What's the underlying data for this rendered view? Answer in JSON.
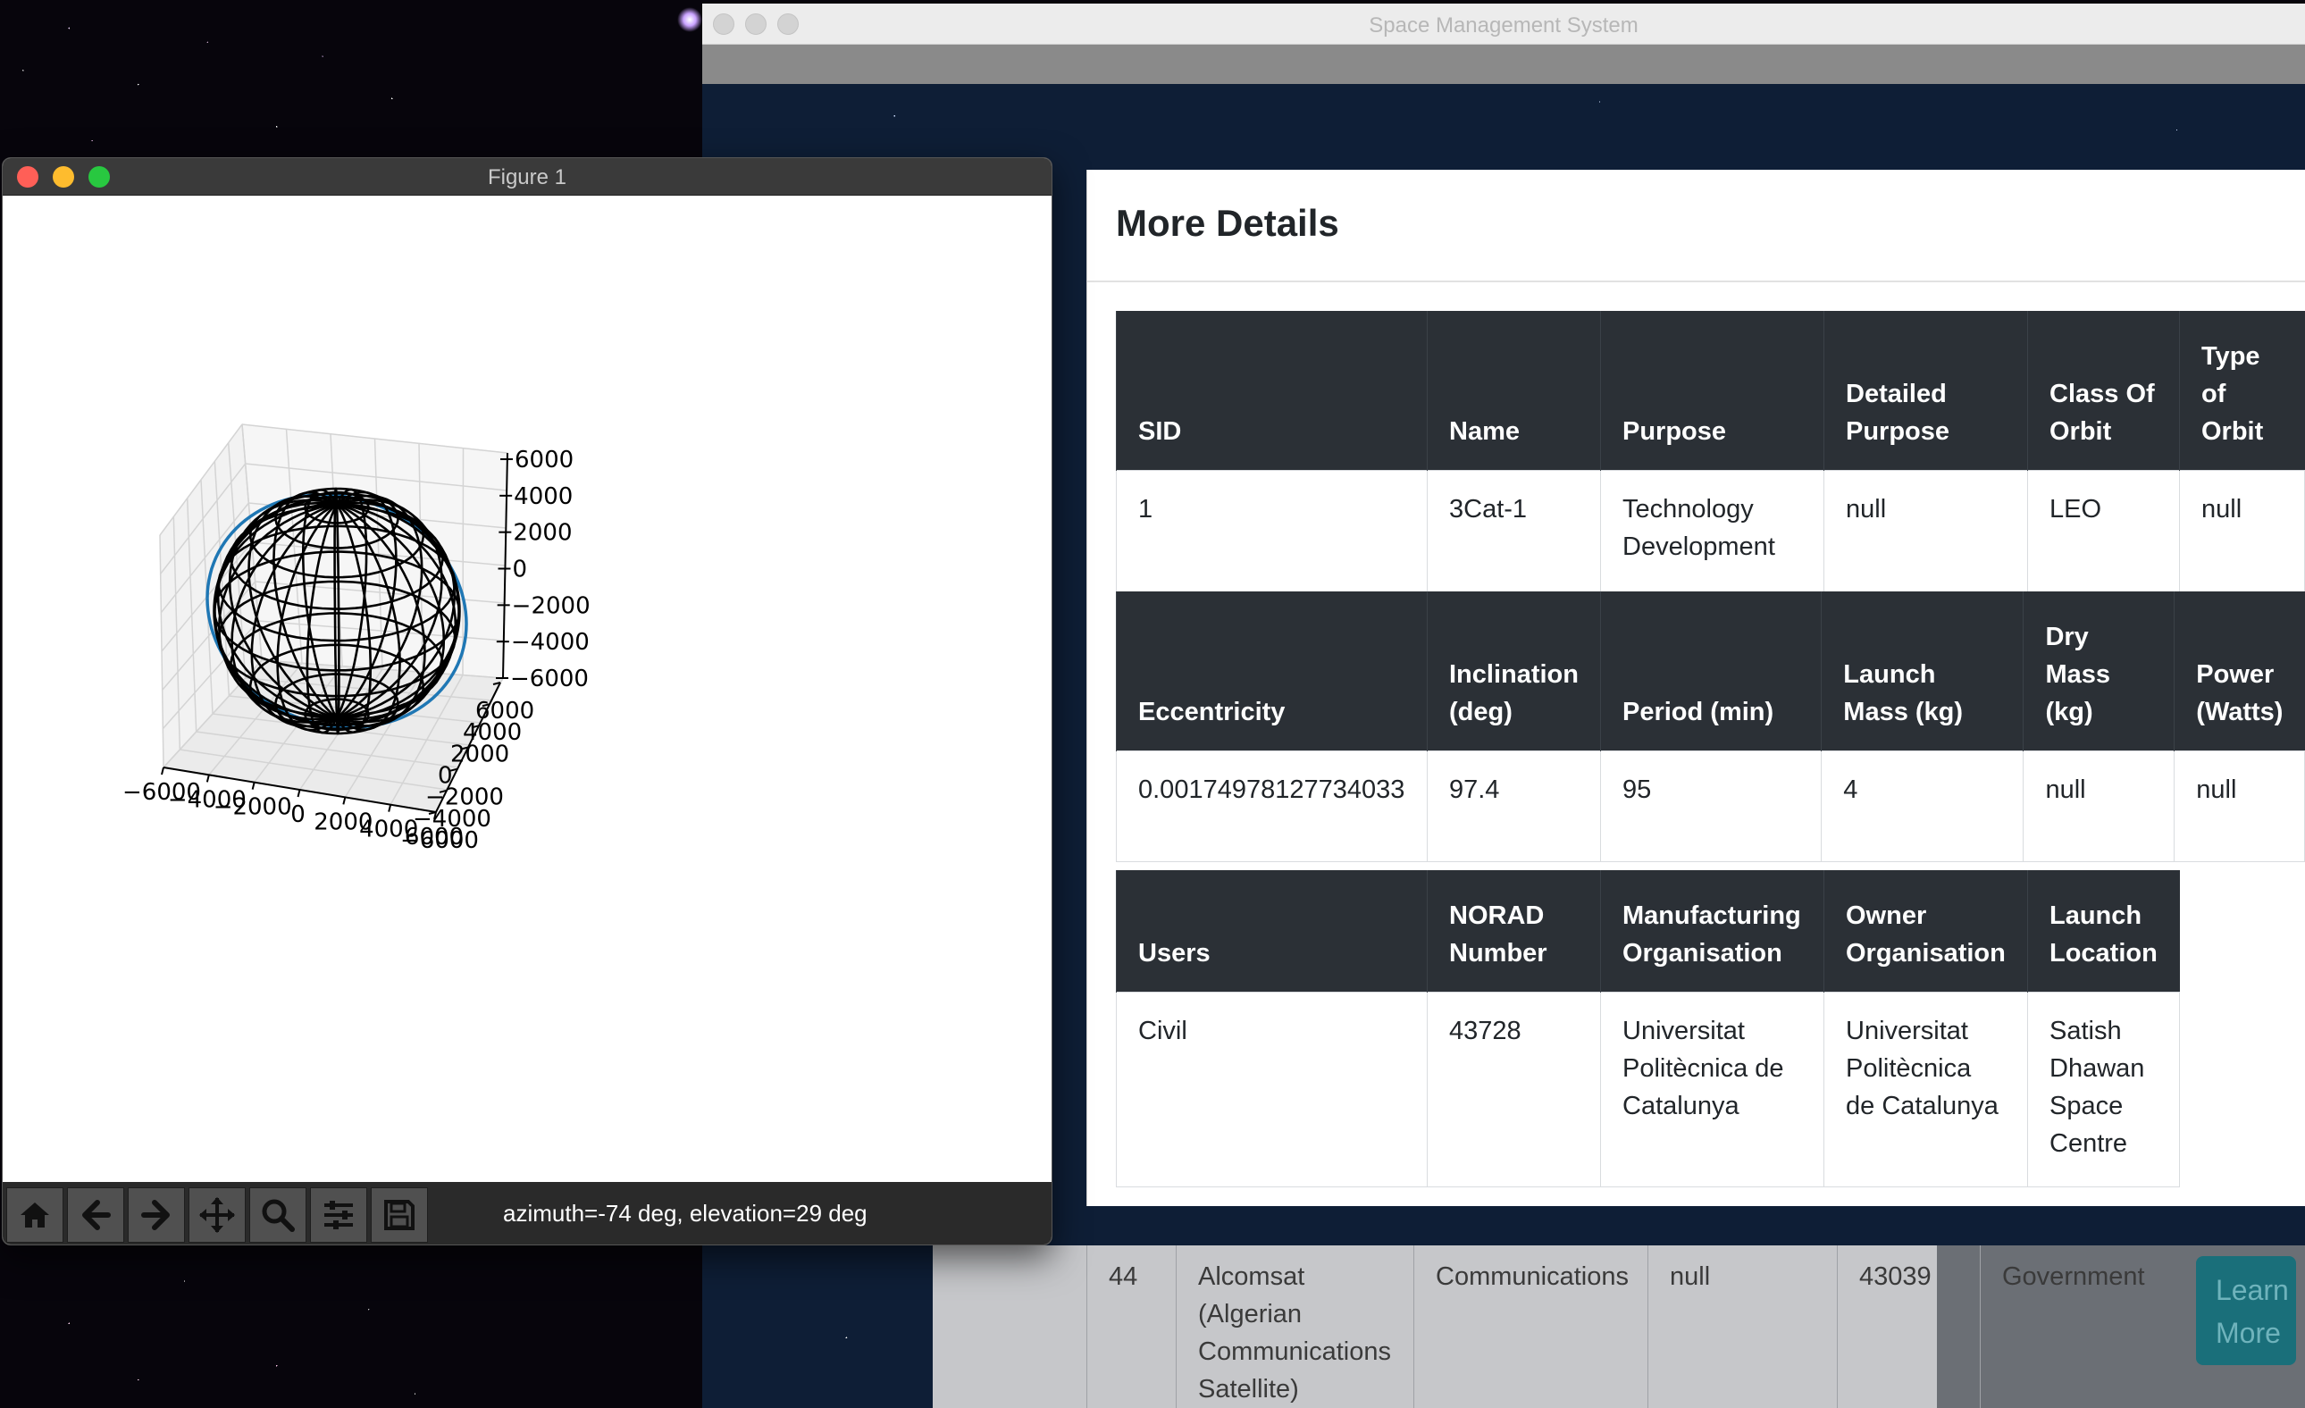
{
  "main_window": {
    "title": "Space Management System",
    "background_row": {
      "cells": [
        "44",
        "Alcomsat (Algerian Communications Satellite)",
        "Communications",
        "null",
        "43039",
        "Government"
      ],
      "button_label": "Learn More"
    },
    "modal": {
      "title": "More Details",
      "rows": [
        {
          "headers": [
            "SID",
            "Name",
            "Purpose",
            "Detailed Purpose",
            "Class Of Orbit",
            "Type of Orbit"
          ],
          "values": [
            "1",
            "3Cat-1",
            "Technology Development",
            "null",
            "LEO",
            "null"
          ]
        },
        {
          "headers": [
            "Eccentricity",
            "Inclination (deg)",
            "Period (min)",
            "Launch Mass (kg)",
            "Dry Mass (kg)",
            "Power (Watts)"
          ],
          "values": [
            "0.00174978127734033",
            "97.4",
            "95",
            "4",
            "null",
            "null"
          ]
        },
        {
          "headers": [
            "Users",
            "NORAD Number",
            "Manufacturing Organisation",
            "Owner Organisation",
            "Launch Location"
          ],
          "values": [
            "Civil",
            "43728",
            "Universitat Politècnica de Catalunya",
            "Universitat Politècnica de Catalunya",
            "Satish Dhawan Space Centre"
          ]
        }
      ]
    }
  },
  "figure_window": {
    "title": "Figure 1",
    "status": "azimuth=-74 deg, elevation=29 deg",
    "toolbar": [
      {
        "icon": "home-icon",
        "tooltip": "home"
      },
      {
        "icon": "back-arrow-icon",
        "tooltip": "back"
      },
      {
        "icon": "forward-arrow-icon",
        "tooltip": "forward"
      },
      {
        "icon": "pan-icon",
        "tooltip": "pan"
      },
      {
        "icon": "zoom-icon",
        "tooltip": "zoom"
      },
      {
        "icon": "configure-subplots-icon",
        "tooltip": "configure"
      },
      {
        "icon": "save-icon",
        "tooltip": "save"
      }
    ],
    "colors": {
      "orbit": "#1f77b4",
      "sphere": "#000000",
      "pane": "#f2f2f2"
    }
  },
  "chart_data": {
    "type": "3d-wireframe",
    "x_ticks": [
      "−6000",
      "−4000",
      "−2000",
      "0",
      "2000",
      "4000",
      "6000"
    ],
    "y_ticks": [
      "6000",
      "4000",
      "2000",
      "0",
      "−2000",
      "−4000",
      "−6000"
    ],
    "z_ticks": [
      "6000",
      "4000",
      "2000",
      "0",
      "−2000",
      "−4000",
      "−6000"
    ],
    "xlim": [
      -6000,
      6000
    ],
    "ylim": [
      -6000,
      6000
    ],
    "zlim": [
      -6000,
      6000
    ],
    "azimuth": -74,
    "elevation": 29,
    "grid": true,
    "series": [
      {
        "kind": "wireframe sphere",
        "color": "#000000"
      },
      {
        "kind": "orbit line",
        "color": "#1f77b4"
      }
    ]
  }
}
